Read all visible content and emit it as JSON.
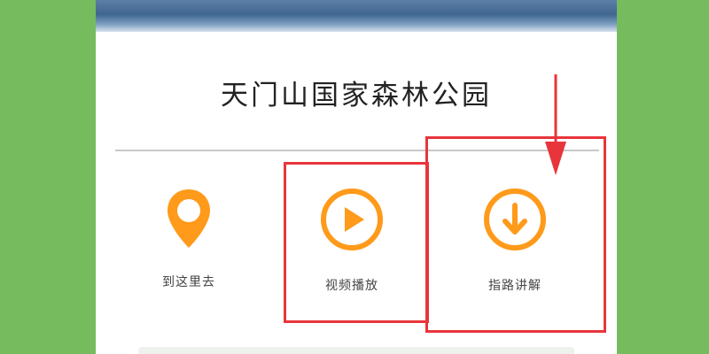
{
  "park": {
    "title": "天门山国家森林公园"
  },
  "actions": [
    {
      "label": "到这里去",
      "icon": "location-pin-icon"
    },
    {
      "label": "视频播放",
      "icon": "play-circle-icon"
    },
    {
      "label": "指路讲解",
      "icon": "download-circle-icon"
    }
  ],
  "colors": {
    "accent": "#ff9a1a",
    "highlight": "#e8353b",
    "background": "#77bb5f"
  }
}
